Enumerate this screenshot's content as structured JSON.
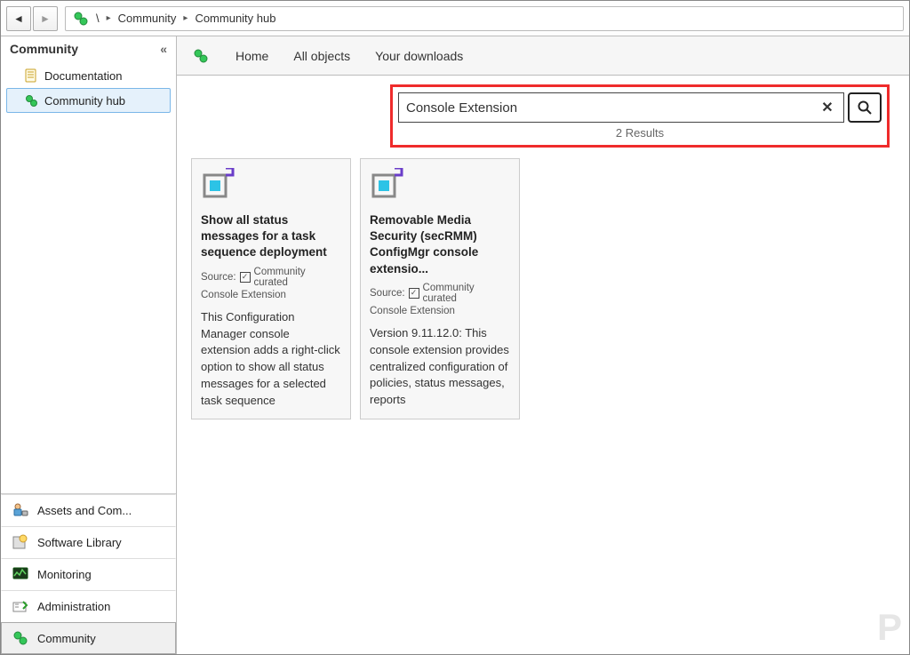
{
  "breadcrumb": {
    "root": "\\",
    "items": [
      "Community",
      "Community hub"
    ]
  },
  "sidebar": {
    "header": "Community",
    "tree": [
      {
        "label": "Documentation",
        "icon": "doc",
        "selected": false
      },
      {
        "label": "Community hub",
        "icon": "hub",
        "selected": true
      }
    ],
    "workspaces": [
      {
        "label": "Assets and Com...",
        "icon": "assets",
        "selected": false
      },
      {
        "label": "Software Library",
        "icon": "software",
        "selected": false
      },
      {
        "label": "Monitoring",
        "icon": "monitoring",
        "selected": false
      },
      {
        "label": "Administration",
        "icon": "admin",
        "selected": false
      },
      {
        "label": "Community",
        "icon": "community",
        "selected": true
      }
    ]
  },
  "tabs": {
    "items": [
      "Home",
      "All objects",
      "Your downloads"
    ]
  },
  "search": {
    "value": "Console Extension",
    "results_label": "2 Results"
  },
  "cards": [
    {
      "title": "Show all status messages for a task sequence deployment",
      "source_prefix": "Source:",
      "source_label": "Community curated",
      "category": "Console Extension",
      "description": "This Configuration Manager console extension adds a right-click option to show all status messages for a selected task sequence"
    },
    {
      "title": "Removable Media Security (secRMM) ConfigMgr console extensio...",
      "source_prefix": "Source:",
      "source_label": "Community curated",
      "category": "Console Extension",
      "description": "Version 9.11.12.0: This console extension provides centralized configuration of policies, status messages, reports"
    }
  ],
  "watermark": "P"
}
